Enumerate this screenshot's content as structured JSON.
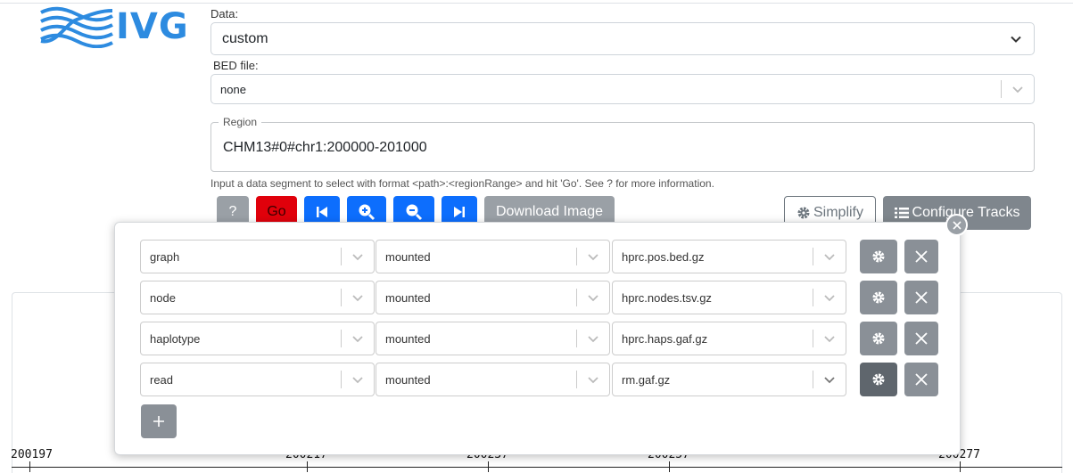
{
  "app": {
    "logo_text": "IVG"
  },
  "data_select": {
    "label": "Data:",
    "value": "custom"
  },
  "bed_select": {
    "label": "BED file:",
    "value": "none"
  },
  "region": {
    "legend": "Region",
    "value": "CHM13#0#chr1:200000-201000"
  },
  "help_text": "Input a data segment to select with format <path>:<regionRange> and hit 'Go'. See ? for more information.",
  "toolbar": {
    "help_label": "?",
    "go_label": "Go",
    "download_label": "Download Image",
    "simplify_label": "Simplify",
    "configure_label": "Configure Tracks"
  },
  "axis_ticks": [
    "200197",
    "200217",
    "200237",
    "200257",
    "200277"
  ],
  "tracks": [
    {
      "type": "graph",
      "source": "mounted",
      "file": "hprc.pos.bed.gz"
    },
    {
      "type": "node",
      "source": "mounted",
      "file": "hprc.nodes.tsv.gz"
    },
    {
      "type": "haplotype",
      "source": "mounted",
      "file": "hprc.haps.gaf.gz"
    },
    {
      "type": "read",
      "source": "mounted",
      "file": "rm.gaf.gz"
    }
  ],
  "colors": {
    "brand": "#2d8be0",
    "primary": "#0d6efd",
    "danger": "#e0000b",
    "secondary": "#8a9097"
  }
}
